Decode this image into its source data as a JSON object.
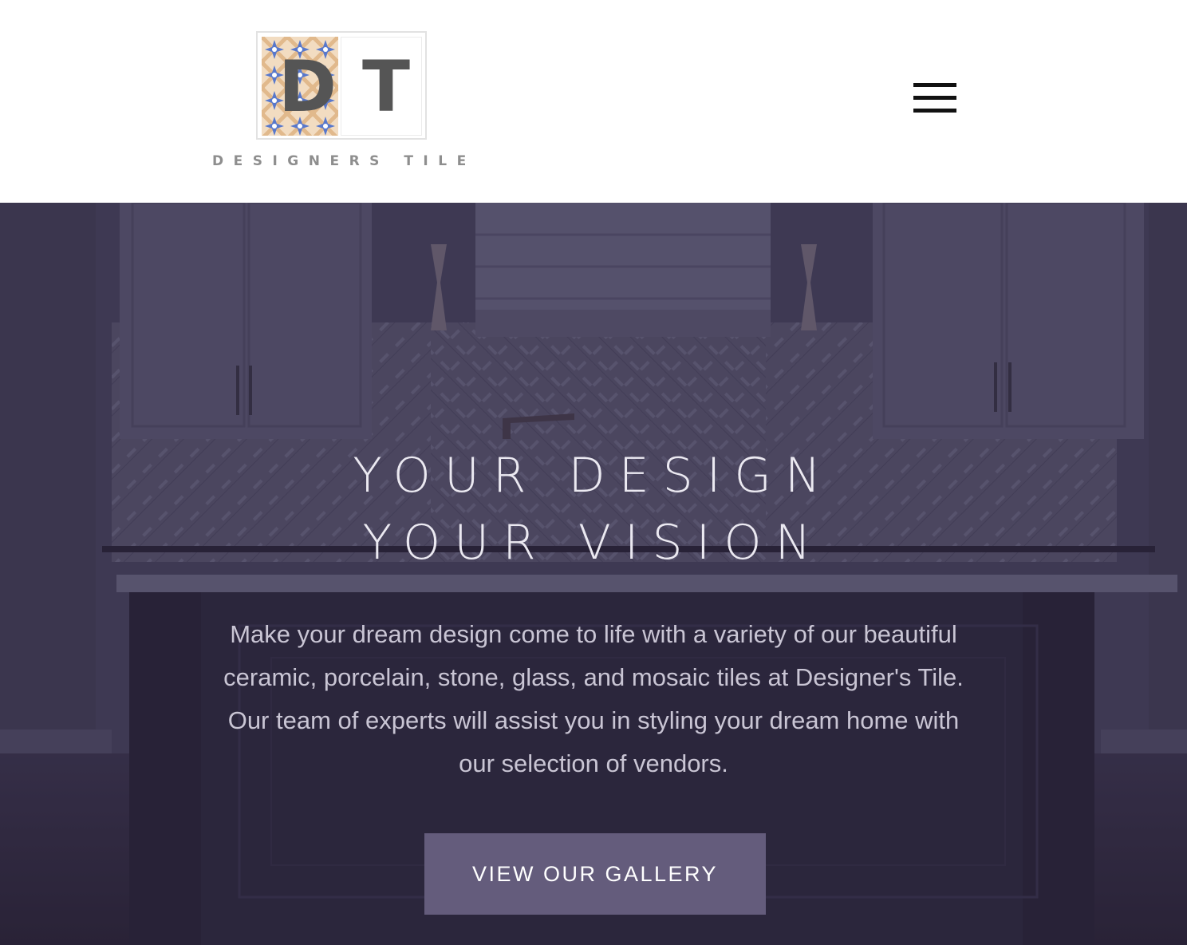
{
  "header": {
    "logo": {
      "letters": [
        "D",
        "T"
      ],
      "wordmark": "DESIGNERS TILE",
      "icon": "tile-pattern-icon"
    },
    "menu": {
      "icon": "hamburger-menu-icon"
    }
  },
  "hero": {
    "title_lines": [
      "YOUR DESIGN",
      "YOUR VISION"
    ],
    "description": "Make your dream design come to life with a variety of our beautiful ceramic, porcelain, stone, glass, and mosaic tiles at Designer's Tile. Our team of experts will assist you in styling your dream home with our selection of vendors.",
    "cta_label": "VIEW OUR GALLERY",
    "background": "kitchen-photo"
  },
  "colors": {
    "hero_tint": "#403c55",
    "cta_background": "#645c7c",
    "logo_gray": "#555555",
    "tile_tan": "#e1b98c",
    "tile_blue": "#5878cc"
  }
}
